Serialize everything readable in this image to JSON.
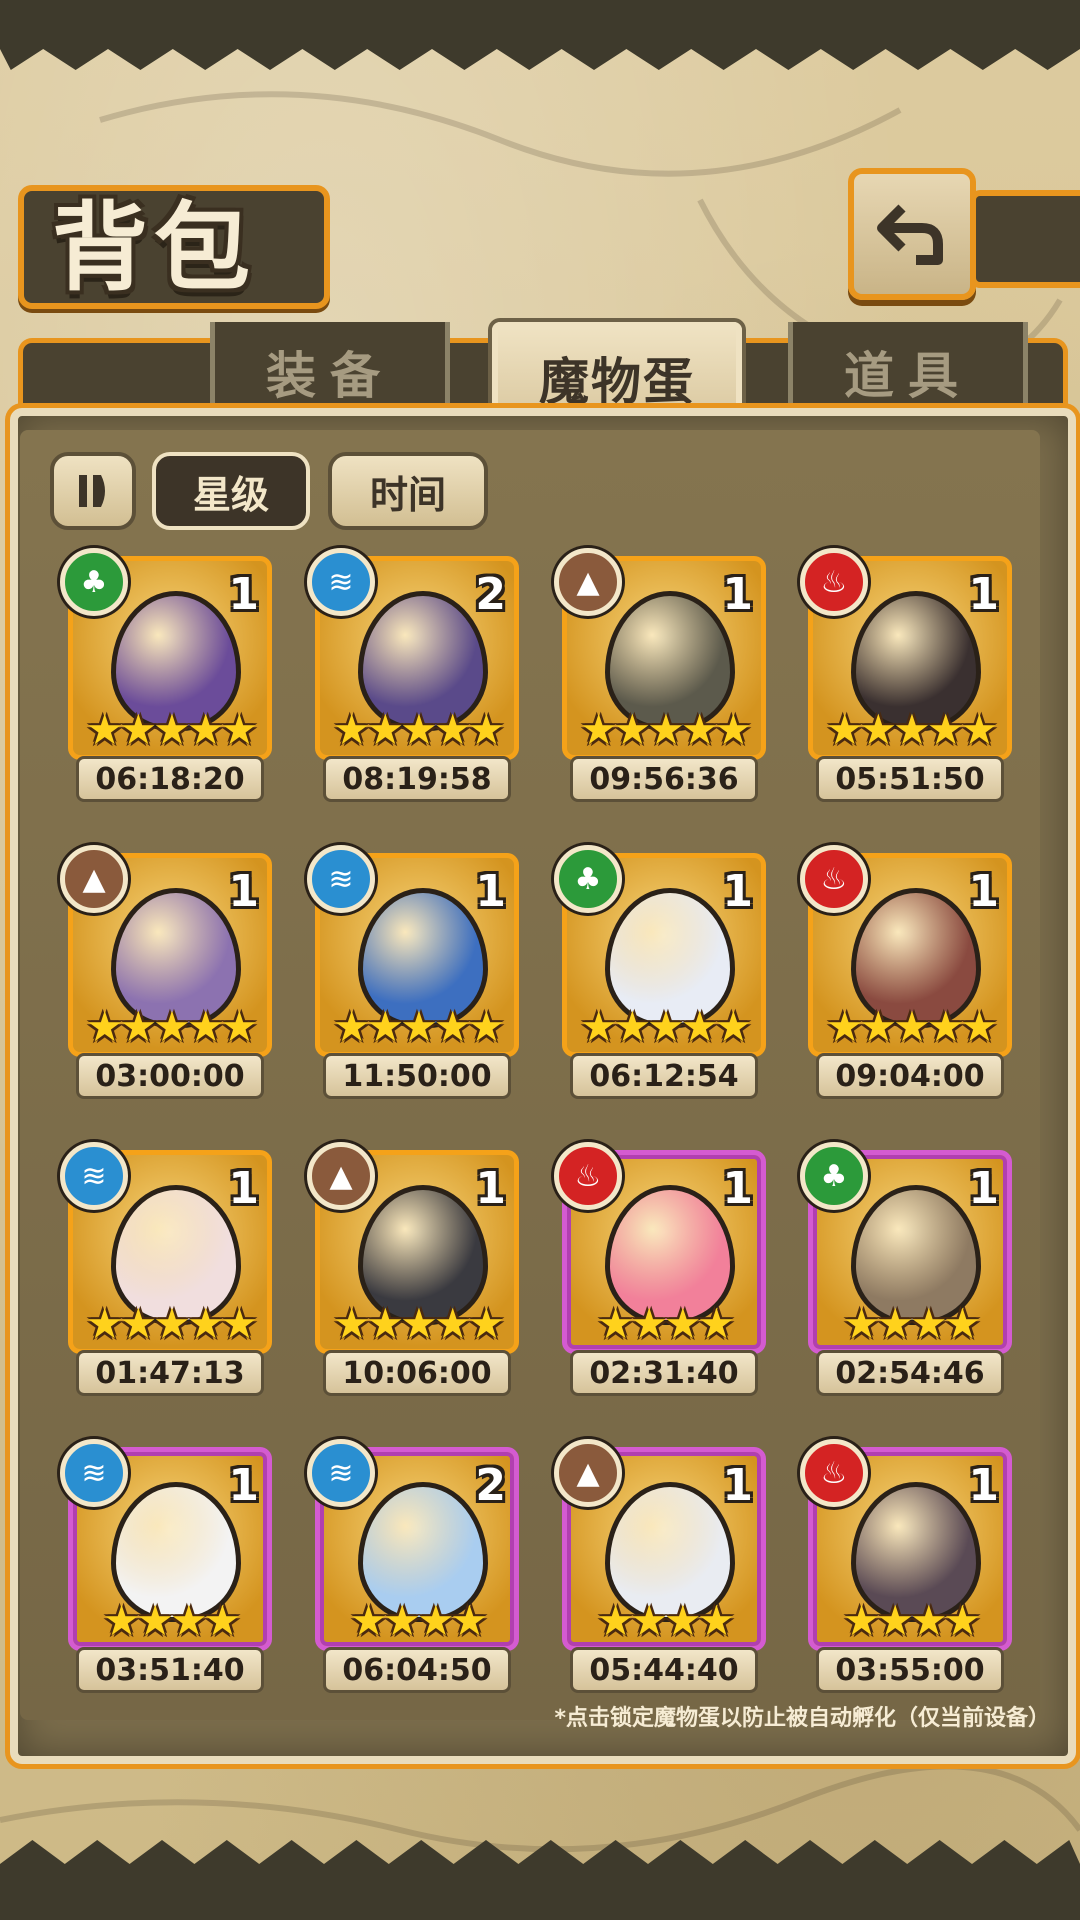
{
  "header": {
    "title": "背包"
  },
  "tabs": [
    {
      "label": "装备",
      "active": false
    },
    {
      "label": "魔物蛋",
      "active": true
    },
    {
      "label": "道具",
      "active": false
    }
  ],
  "sort": {
    "star_label": "星级",
    "time_label": "时间"
  },
  "colors": {
    "frame_orange": "#e8951e",
    "frame_purple": "#d45bd1"
  },
  "eggs": [
    {
      "element": "wood",
      "count": "1",
      "stars": 5,
      "frame": "orange",
      "timer": "06:18:20",
      "color": "#6b4c9a"
    },
    {
      "element": "water",
      "count": "2",
      "stars": 5,
      "frame": "orange",
      "timer": "08:19:58",
      "color": "#5a4a8a"
    },
    {
      "element": "earth",
      "count": "1",
      "stars": 5,
      "frame": "orange",
      "timer": "09:56:36",
      "color": "#5c5a4c"
    },
    {
      "element": "fire",
      "count": "1",
      "stars": 5,
      "frame": "orange",
      "timer": "05:51:50",
      "color": "#3a3030"
    },
    {
      "element": "earth",
      "count": "1",
      "stars": 5,
      "frame": "orange",
      "timer": "03:00:00",
      "color": "#8c72b0"
    },
    {
      "element": "water",
      "count": "1",
      "stars": 5,
      "frame": "orange",
      "timer": "11:50:00",
      "color": "#3d6fc0"
    },
    {
      "element": "wood",
      "count": "1",
      "stars": 5,
      "frame": "orange",
      "timer": "06:12:54",
      "color": "#e8ecf5"
    },
    {
      "element": "fire",
      "count": "1",
      "stars": 5,
      "frame": "orange",
      "timer": "09:04:00",
      "color": "#8a4a40"
    },
    {
      "element": "water",
      "count": "1",
      "stars": 5,
      "frame": "orange",
      "timer": "01:47:13",
      "color": "#f1dede"
    },
    {
      "element": "earth",
      "count": "1",
      "stars": 5,
      "frame": "orange",
      "timer": "10:06:00",
      "color": "#3a3a40"
    },
    {
      "element": "fire",
      "count": "1",
      "stars": 4,
      "frame": "purple",
      "timer": "02:31:40",
      "color": "#f2809a"
    },
    {
      "element": "wood",
      "count": "1",
      "stars": 4,
      "frame": "purple",
      "timer": "02:54:46",
      "color": "#8e7a62"
    },
    {
      "element": "water",
      "count": "1",
      "stars": 4,
      "frame": "purple",
      "timer": "03:51:40",
      "color": "#f3f3f3"
    },
    {
      "element": "water",
      "count": "2",
      "stars": 4,
      "frame": "purple",
      "timer": "06:04:50",
      "color": "#a9cdf0"
    },
    {
      "element": "earth",
      "count": "1",
      "stars": 4,
      "frame": "purple",
      "timer": "05:44:40",
      "color": "#e9ecf2"
    },
    {
      "element": "fire",
      "count": "1",
      "stars": 4,
      "frame": "purple",
      "timer": "03:55:00",
      "color": "#5a4a55"
    }
  ],
  "footer_note": "*点击锁定魔物蛋以防止被自动孵化（仅当前设备）"
}
